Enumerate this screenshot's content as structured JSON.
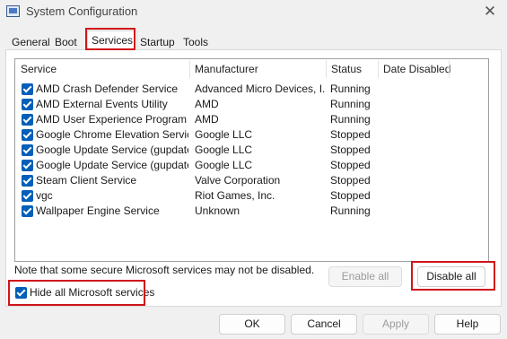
{
  "window": {
    "title": "System Configuration",
    "close_glyph": "✕",
    "icon": "system-configuration-icon"
  },
  "tabs": [
    {
      "label": "General",
      "active": false
    },
    {
      "label": "Boot",
      "active": false
    },
    {
      "label": "Services",
      "active": true
    },
    {
      "label": "Startup",
      "active": false
    },
    {
      "label": "Tools",
      "active": false
    }
  ],
  "services": {
    "columns": [
      "Service",
      "Manufacturer",
      "Status",
      "Date Disabled"
    ],
    "rows": [
      {
        "checked": true,
        "service": "AMD Crash Defender Service",
        "manufacturer": "Advanced Micro Devices, I...",
        "status": "Running",
        "date_disabled": ""
      },
      {
        "checked": true,
        "service": "AMD External Events Utility",
        "manufacturer": "AMD",
        "status": "Running",
        "date_disabled": ""
      },
      {
        "checked": true,
        "service": "AMD User Experience Program D...",
        "manufacturer": "AMD",
        "status": "Running",
        "date_disabled": ""
      },
      {
        "checked": true,
        "service": "Google Chrome Elevation Servic...",
        "manufacturer": "Google LLC",
        "status": "Stopped",
        "date_disabled": ""
      },
      {
        "checked": true,
        "service": "Google Update Service (gupdate)",
        "manufacturer": "Google LLC",
        "status": "Stopped",
        "date_disabled": ""
      },
      {
        "checked": true,
        "service": "Google Update Service (gupdatem)",
        "manufacturer": "Google LLC",
        "status": "Stopped",
        "date_disabled": ""
      },
      {
        "checked": true,
        "service": "Steam Client Service",
        "manufacturer": "Valve Corporation",
        "status": "Stopped",
        "date_disabled": ""
      },
      {
        "checked": true,
        "service": "vgc",
        "manufacturer": "Riot Games, Inc.",
        "status": "Stopped",
        "date_disabled": ""
      },
      {
        "checked": true,
        "service": "Wallpaper Engine Service",
        "manufacturer": "Unknown",
        "status": "Running",
        "date_disabled": ""
      }
    ]
  },
  "note": "Note that some secure Microsoft services may not be disabled.",
  "buttons": {
    "enable_all": "Enable all",
    "disable_all": "Disable all",
    "ok": "OK",
    "cancel": "Cancel",
    "apply": "Apply",
    "help": "Help"
  },
  "hide_microsoft": {
    "label": "Hide all Microsoft services",
    "checked": true
  },
  "colors": {
    "checkbox": "#005fb8",
    "highlight": "#d0141a"
  }
}
